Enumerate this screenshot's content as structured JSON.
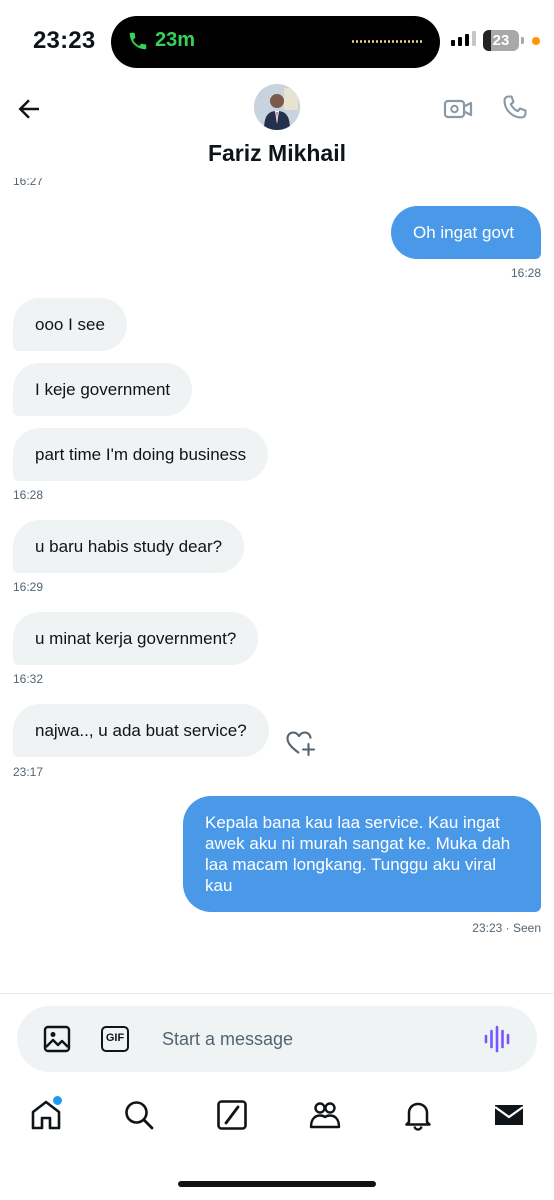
{
  "status_bar": {
    "time": "23:23",
    "call_duration": "23m",
    "battery": "23",
    "battery_level": 0.23
  },
  "header": {
    "contact_name": "Fariz Mikhail"
  },
  "messages": [
    {
      "kind": "timestamp",
      "side": "left",
      "text": "16:27"
    },
    {
      "kind": "bubble",
      "side": "out",
      "text": "Oh ingat govt"
    },
    {
      "kind": "timestamp",
      "side": "right",
      "text": "16:28"
    },
    {
      "kind": "bubble",
      "side": "in",
      "text": "ooo I see"
    },
    {
      "kind": "bubble",
      "side": "in",
      "text": "I keje government"
    },
    {
      "kind": "bubble",
      "side": "in",
      "text": "part time I'm doing business"
    },
    {
      "kind": "timestamp",
      "side": "left",
      "text": "16:28"
    },
    {
      "kind": "bubble",
      "side": "in",
      "text": "u baru habis study dear?"
    },
    {
      "kind": "timestamp",
      "side": "left",
      "text": "16:29"
    },
    {
      "kind": "bubble",
      "side": "in",
      "text": "u minat kerja government?"
    },
    {
      "kind": "timestamp",
      "side": "left",
      "text": "16:32"
    },
    {
      "kind": "bubble",
      "side": "in",
      "text": "najwa.., u ada buat service?"
    },
    {
      "kind": "timestamp",
      "side": "left",
      "text": "23:17"
    },
    {
      "kind": "bubble",
      "side": "out",
      "text": "Kepala bana kau laa service. Kau ingat awek aku ni murah sangat ke. Muka dah laa macam longkang. Tunggu aku viral kau"
    },
    {
      "kind": "timestamp",
      "side": "right",
      "text": "23:23 · Seen"
    }
  ],
  "composer": {
    "placeholder": "Start a message",
    "gif_label": "GIF"
  },
  "nav": {
    "items": [
      "home",
      "search",
      "grok",
      "communities",
      "notifications",
      "messages"
    ],
    "home_has_badge": true
  },
  "colors": {
    "outgoing_bubble": "#4a99e9",
    "incoming_bubble": "#eff3f4",
    "accent": "#1d9bf0",
    "voice_icon": "#7856ff",
    "call_green": "#37d159"
  }
}
